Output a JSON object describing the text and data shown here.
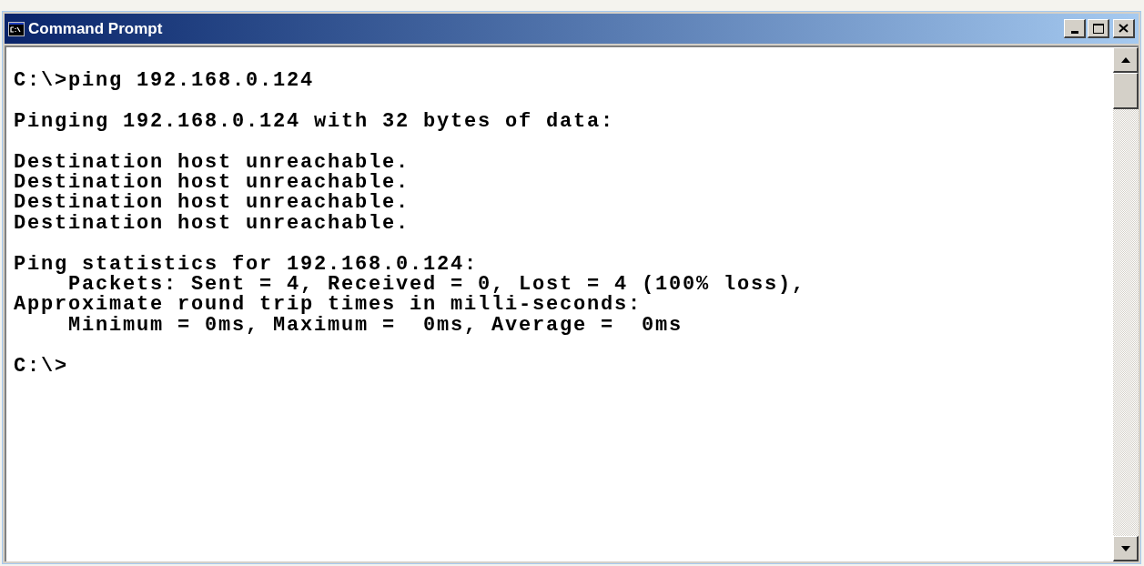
{
  "window": {
    "title": "Command Prompt"
  },
  "console": {
    "blocks": [
      [
        "C:\\>ping 192.168.0.124"
      ],
      [
        "Pinging 192.168.0.124 with 32 bytes of data:"
      ],
      [
        "Destination host unreachable.",
        "Destination host unreachable.",
        "Destination host unreachable.",
        "Destination host unreachable."
      ],
      [
        "Ping statistics for 192.168.0.124:",
        "    Packets: Sent = 4, Received = 0, Lost = 4 (100% loss),",
        "Approximate round trip times in milli-seconds:",
        "    Minimum = 0ms, Maximum =  0ms, Average =  0ms"
      ],
      [
        "C:\\>"
      ]
    ]
  }
}
